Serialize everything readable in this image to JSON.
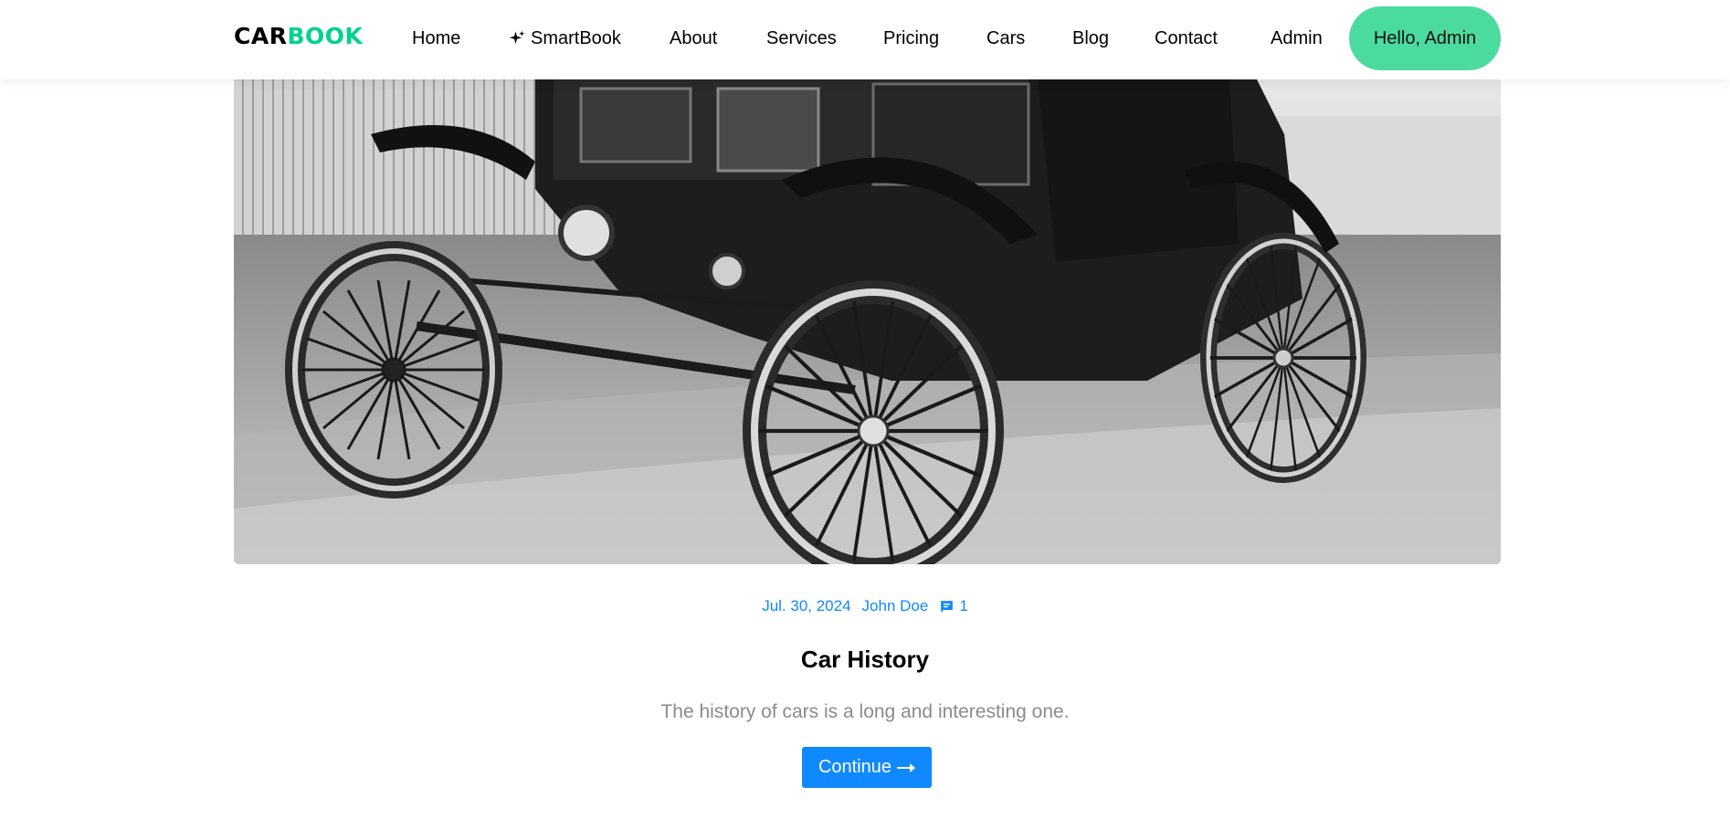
{
  "brand": {
    "part1": "CAR",
    "part2": "BOOK"
  },
  "nav": {
    "items": [
      {
        "label": "Home"
      },
      {
        "label": "SmartBook"
      },
      {
        "label": "About"
      },
      {
        "label": "Services"
      },
      {
        "label": "Pricing"
      },
      {
        "label": "Cars"
      },
      {
        "label": "Blog"
      },
      {
        "label": "Contact"
      },
      {
        "label": "Admin"
      }
    ],
    "greeting": "Hello, Admin"
  },
  "post": {
    "date": "Jul. 30, 2024",
    "author": "John Doe",
    "comment_count": "1",
    "title": "Car History",
    "excerpt": "The history of cars is a long and interesting one.",
    "continue_label": "Continue"
  },
  "colors": {
    "brand_accent": "#01d28e",
    "greeting_bg": "#4cdb9f",
    "link_blue": "#1089ff",
    "excerpt_gray": "#8b8b8b"
  },
  "icons": {
    "smartbook": "sparkle-icon",
    "comments": "chat-icon",
    "continue": "arrow-right-icon"
  }
}
